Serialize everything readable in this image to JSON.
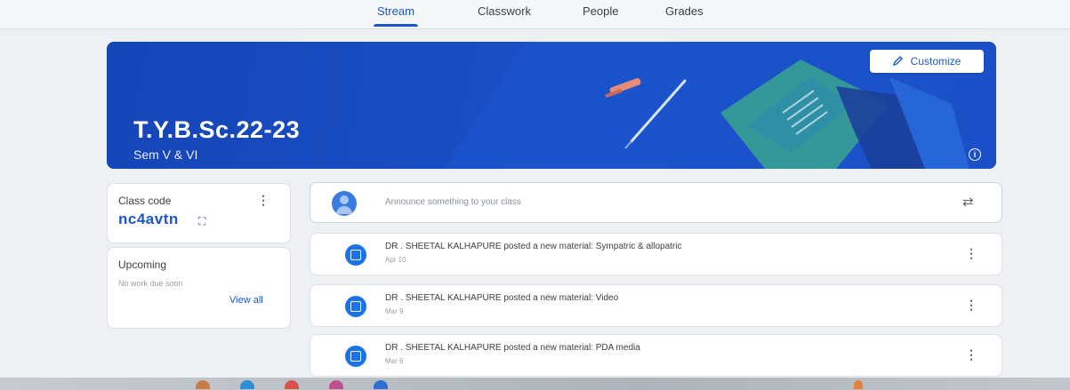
{
  "tabs": [
    "Stream",
    "Classwork",
    "People",
    "Grades"
  ],
  "active_tab": "Stream",
  "banner": {
    "title": "T.Y.B.Sc.22-23",
    "subtitle": "Sem V & VI",
    "customize_label": "Customize",
    "info_icon": "info-icon"
  },
  "class_code": {
    "label": "Class code",
    "value": "nc4avtn"
  },
  "upcoming": {
    "label": "Upcoming",
    "empty_text": "No work due soon",
    "view_all_label": "View all"
  },
  "announce": {
    "placeholder": "Announce something to your class"
  },
  "posts": [
    {
      "title": "DR . SHEETAL KALHAPURE posted a new material: Sympatric & allopatric",
      "date": "Apr 10"
    },
    {
      "title": "DR . SHEETAL KALHAPURE posted a new material: Video",
      "date": "Mar 9"
    },
    {
      "title": "DR . SHEETAL KALHAPURE posted a new material: PDA media",
      "date": "Mar 6"
    }
  ],
  "colors": {
    "accent": "#1a57c9",
    "banner": "#1a4fc6",
    "background": "#eef0f3"
  }
}
